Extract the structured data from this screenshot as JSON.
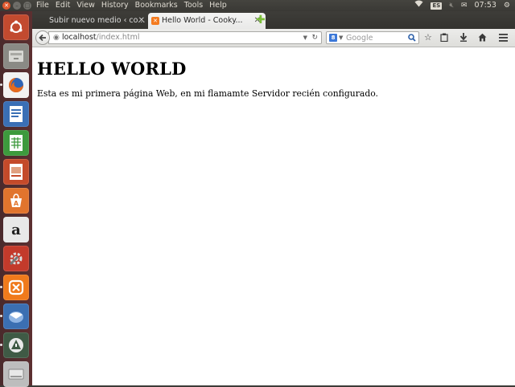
{
  "top_panel": {
    "menu": [
      "File",
      "Edit",
      "View",
      "History",
      "Bookmarks",
      "Tools",
      "Help"
    ],
    "keyboard_layout": "ES",
    "clock": "07:53"
  },
  "tabs": [
    {
      "title": "Subir nuevo medio ‹ co...",
      "active": false
    },
    {
      "title": "Hello World - Cooky...",
      "active": true
    }
  ],
  "url": {
    "host": "localhost",
    "path": "/index.html"
  },
  "search": {
    "placeholder": "Google"
  },
  "page": {
    "heading": "HELLO WORLD",
    "paragraph": "Esta es mi primera página Web, en mi flamamte Servidor recién configurado."
  },
  "launcher": [
    {
      "name": "ubuntu-dash-icon",
      "color": "#c24a2f"
    },
    {
      "name": "files-icon",
      "color": "#8a8a85"
    },
    {
      "name": "firefox-icon",
      "color": "#e66a1e"
    },
    {
      "name": "writer-icon",
      "color": "#3a6fb5"
    },
    {
      "name": "calc-icon",
      "color": "#3d9a3d"
    },
    {
      "name": "impress-icon",
      "color": "#c44a2a"
    },
    {
      "name": "software-center-icon",
      "color": "#e1742d"
    },
    {
      "name": "amazon-icon",
      "color": "#e8e8e8"
    },
    {
      "name": "system-settings-icon",
      "color": "#c33a2b"
    },
    {
      "name": "xampp-icon",
      "color": "#f07a1c"
    },
    {
      "name": "thunderbird-icon",
      "color": "#3b6fb2"
    },
    {
      "name": "software-updater-icon",
      "color": "#3f5a45"
    },
    {
      "name": "device-icon",
      "color": "#bdbdbd"
    }
  ]
}
